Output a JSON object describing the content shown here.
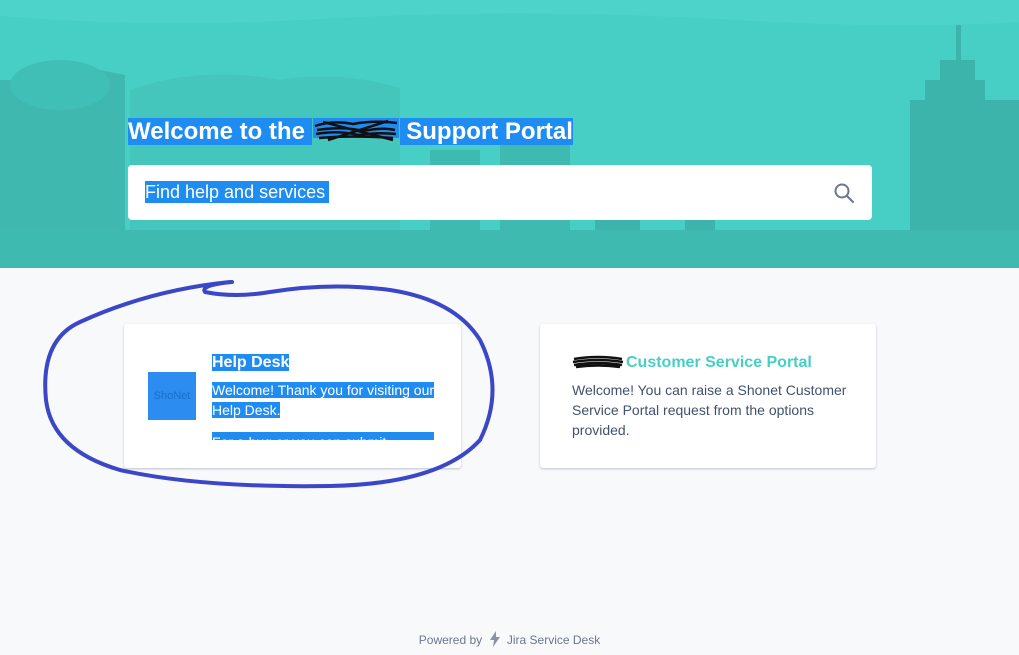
{
  "hero": {
    "title_prefix": "Welcome to the",
    "title_suffix": "Support Portal",
    "background": "#48cfc5"
  },
  "search": {
    "placeholder": "Find help and services",
    "icon": "search-icon"
  },
  "cards": [
    {
      "title": "Help Desk",
      "logo_text": "ShoNet",
      "description": "Welcome! Thank you for visiting our Help Desk.",
      "description_cont": "For a bug or you can submit Support"
    },
    {
      "title": "Customer Service Portal",
      "description": "Welcome! You can raise a Shonet Customer Service Portal request from the options provided."
    }
  ],
  "footer": {
    "powered_by": "Powered by",
    "brand": "Jira Service Desk",
    "icon": "bolt-icon"
  },
  "colors": {
    "accent": "#48cfc5",
    "selection": "#1f8cf2",
    "annotation": "#3c47c7"
  }
}
